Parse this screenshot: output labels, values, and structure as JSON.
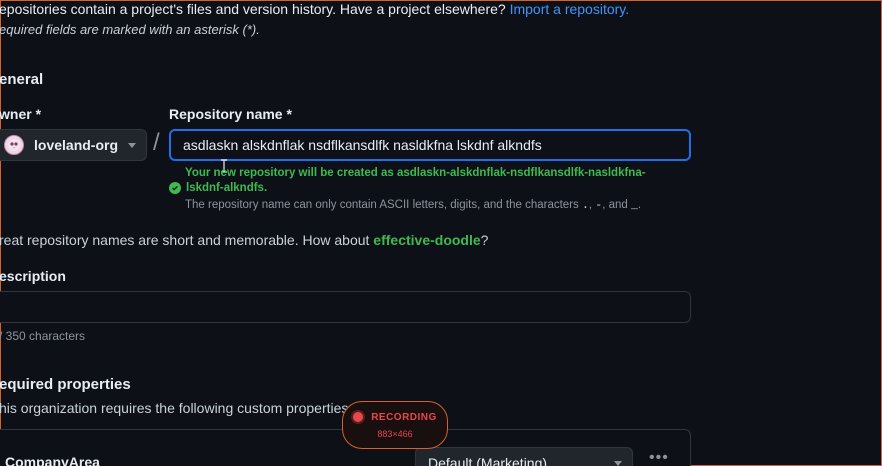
{
  "intro": {
    "text": "epositories contain a project's files and version history. Have a project elsewhere?",
    "import_link": "Import a repository."
  },
  "required_note": "equired fields are marked with an asterisk (*).",
  "general": {
    "title": "eneral",
    "owner_label": "wner *",
    "owner_value": "loveland-org",
    "repo_label": "Repository name *",
    "repo_value": "asdlaskn alskdnflak nsdflkansdlfk nasldkfna lskdnf alkndfs",
    "separator": "/",
    "success_line1": "Your new repository will be created as asdlaskn-alskdnflak-nsdflkansdlfk-nasldkfna-",
    "success_line2": "lskdnf-alkndfs.",
    "hint_prefix": "The repository name can only contain ASCII letters, digits, and the characters",
    "hint_chars1": ".",
    "hint_sep1": ",",
    "hint_chars2": "-",
    "hint_sep2": ", and",
    "hint_chars3": "_",
    "hint_end": ".",
    "great_prefix": "reat repository names are short and memorable. How about",
    "suggestion": "effective-doodle",
    "great_suffix": "?"
  },
  "description": {
    "label": "escription",
    "char_count": "/ 350 characters"
  },
  "required_properties": {
    "title": "equired properties",
    "note": "his organization requires the following custom properties",
    "property_name": "CompanyArea",
    "property_value": "Default (Marketing)",
    "more": "•••"
  },
  "recording": {
    "label": "RECORDING",
    "dims": "883×466"
  }
}
